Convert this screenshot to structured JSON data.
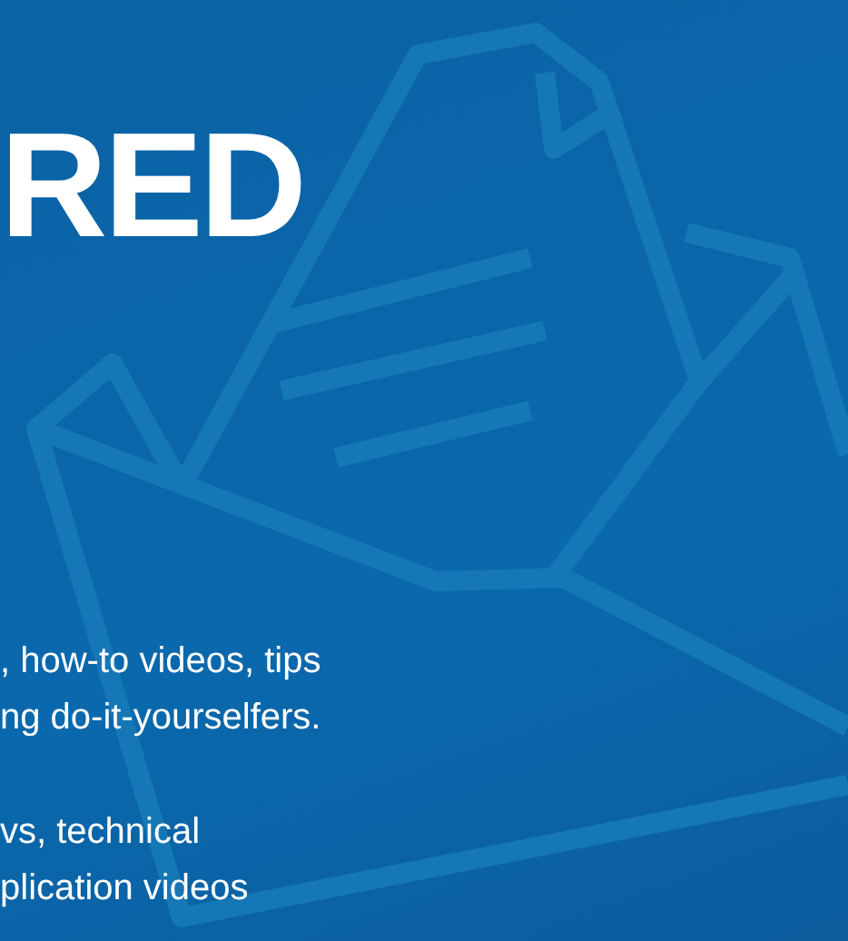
{
  "heading": "RED",
  "paragraphs": [
    {
      "lines": [
        ", how-to videos, tips",
        "ng do-it-yourselfers."
      ]
    },
    {
      "lines": [
        "vs, technical",
        "plication videos"
      ]
    }
  ]
}
